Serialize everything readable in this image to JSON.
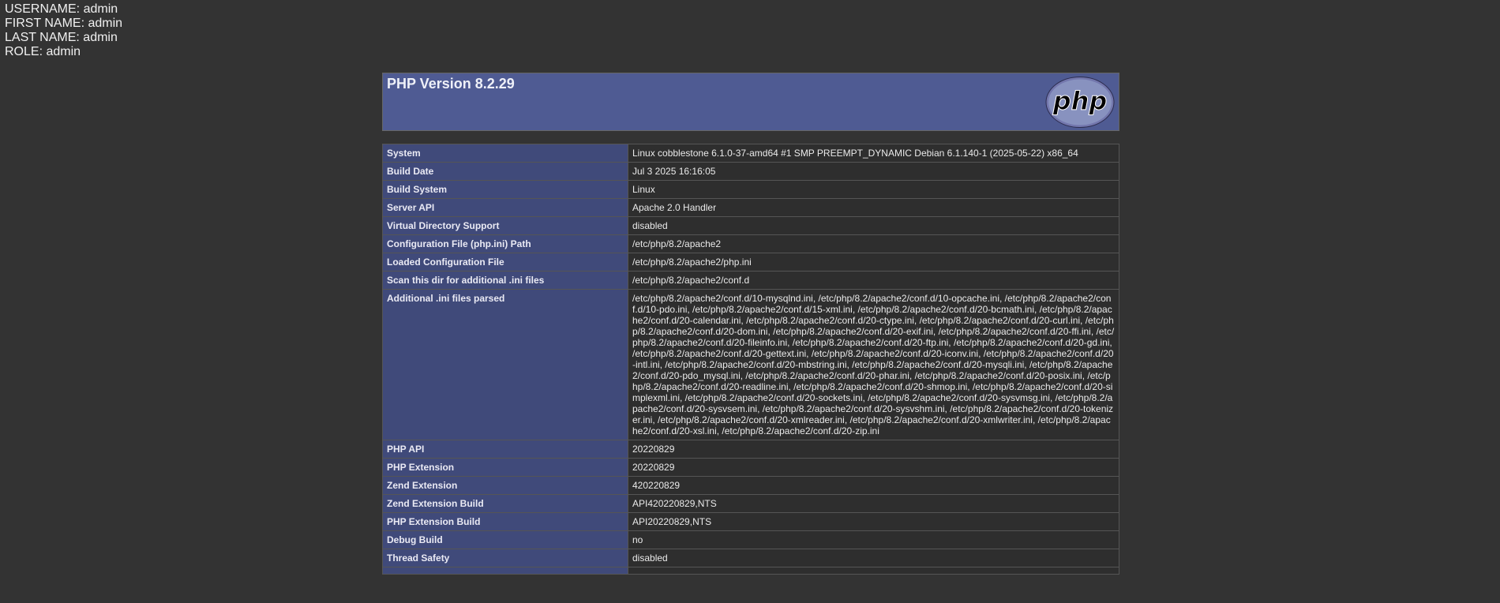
{
  "user": {
    "username": "USERNAME: admin",
    "first_name": "FIRST NAME: admin",
    "last_name": "LAST NAME: admin",
    "role": "ROLE: admin"
  },
  "header": {
    "title": "PHP Version 8.2.29",
    "logo_text": "php"
  },
  "rows": [
    {
      "key": "System",
      "value": "Linux cobblestone 6.1.0-37-amd64 #1 SMP PREEMPT_DYNAMIC Debian 6.1.140-1 (2025-05-22) x86_64"
    },
    {
      "key": "Build Date",
      "value": "Jul 3 2025 16:16:05"
    },
    {
      "key": "Build System",
      "value": "Linux"
    },
    {
      "key": "Server API",
      "value": "Apache 2.0 Handler"
    },
    {
      "key": "Virtual Directory Support",
      "value": "disabled"
    },
    {
      "key": "Configuration File (php.ini) Path",
      "value": "/etc/php/8.2/apache2"
    },
    {
      "key": "Loaded Configuration File",
      "value": "/etc/php/8.2/apache2/php.ini"
    },
    {
      "key": "Scan this dir for additional .ini files",
      "value": "/etc/php/8.2/apache2/conf.d"
    },
    {
      "key": "Additional .ini files parsed",
      "value": "/etc/php/8.2/apache2/conf.d/10-mysqlnd.ini, /etc/php/8.2/apache2/conf.d/10-opcache.ini, /etc/php/8.2/apache2/conf.d/10-pdo.ini, /etc/php/8.2/apache2/conf.d/15-xml.ini, /etc/php/8.2/apache2/conf.d/20-bcmath.ini, /etc/php/8.2/apache2/conf.d/20-calendar.ini, /etc/php/8.2/apache2/conf.d/20-ctype.ini, /etc/php/8.2/apache2/conf.d/20-curl.ini, /etc/php/8.2/apache2/conf.d/20-dom.ini, /etc/php/8.2/apache2/conf.d/20-exif.ini, /etc/php/8.2/apache2/conf.d/20-ffi.ini, /etc/php/8.2/apache2/conf.d/20-fileinfo.ini, /etc/php/8.2/apache2/conf.d/20-ftp.ini, /etc/php/8.2/apache2/conf.d/20-gd.ini, /etc/php/8.2/apache2/conf.d/20-gettext.ini, /etc/php/8.2/apache2/conf.d/20-iconv.ini, /etc/php/8.2/apache2/conf.d/20-intl.ini, /etc/php/8.2/apache2/conf.d/20-mbstring.ini, /etc/php/8.2/apache2/conf.d/20-mysqli.ini, /etc/php/8.2/apache2/conf.d/20-pdo_mysql.ini, /etc/php/8.2/apache2/conf.d/20-phar.ini, /etc/php/8.2/apache2/conf.d/20-posix.ini, /etc/php/8.2/apache2/conf.d/20-readline.ini, /etc/php/8.2/apache2/conf.d/20-shmop.ini, /etc/php/8.2/apache2/conf.d/20-simplexml.ini, /etc/php/8.2/apache2/conf.d/20-sockets.ini, /etc/php/8.2/apache2/conf.d/20-sysvmsg.ini, /etc/php/8.2/apache2/conf.d/20-sysvsem.ini, /etc/php/8.2/apache2/conf.d/20-sysvshm.ini, /etc/php/8.2/apache2/conf.d/20-tokenizer.ini, /etc/php/8.2/apache2/conf.d/20-xmlreader.ini, /etc/php/8.2/apache2/conf.d/20-xmlwriter.ini, /etc/php/8.2/apache2/conf.d/20-xsl.ini, /etc/php/8.2/apache2/conf.d/20-zip.ini"
    },
    {
      "key": "PHP API",
      "value": "20220829"
    },
    {
      "key": "PHP Extension",
      "value": "20220829"
    },
    {
      "key": "Zend Extension",
      "value": "420220829"
    },
    {
      "key": "Zend Extension Build",
      "value": "API420220829,NTS"
    },
    {
      "key": "PHP Extension Build",
      "value": "API20220829,NTS"
    },
    {
      "key": "Debug Build",
      "value": "no"
    },
    {
      "key": "Thread Safety",
      "value": "disabled"
    },
    {
      "key": "",
      "value": ""
    }
  ]
}
